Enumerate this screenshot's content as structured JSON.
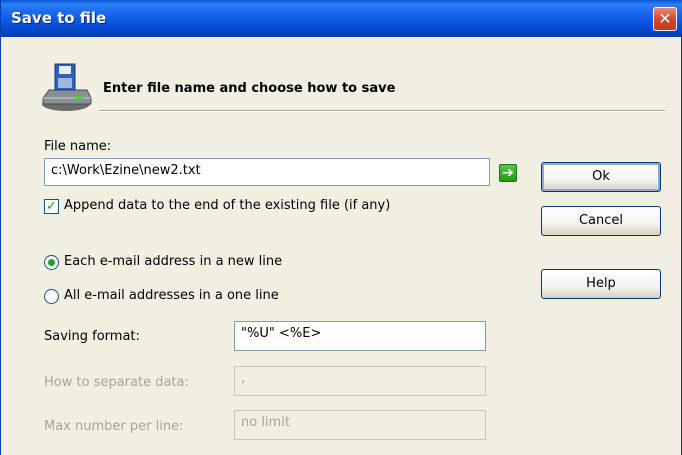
{
  "window": {
    "title": "Save to file",
    "close_symbol": "✕"
  },
  "header": {
    "text": "Enter file name and choose how to save",
    "icon": "floppy-disk-drive-icon"
  },
  "file_name": {
    "label": "File name:",
    "value": "c:\\Work\\Ezine\\new2.txt",
    "go_icon": "➔"
  },
  "append": {
    "label": "Append data to the end of the existing file (if any)",
    "checked": true,
    "check_mark": "✓"
  },
  "radios": {
    "each_line": {
      "label": "Each e-mail address in a new line",
      "selected": true
    },
    "one_line": {
      "label": "All e-mail addresses in a one line",
      "selected": false
    }
  },
  "saving_format": {
    "label": "Saving format:",
    "value": "\"%U\" <%E>"
  },
  "separate": {
    "label": "How to separate data:",
    "value": ","
  },
  "max_per_line": {
    "label": "Max number per line:",
    "value": "no limit"
  },
  "buttons": {
    "ok": "Ok",
    "cancel": "Cancel",
    "help": "Help"
  }
}
